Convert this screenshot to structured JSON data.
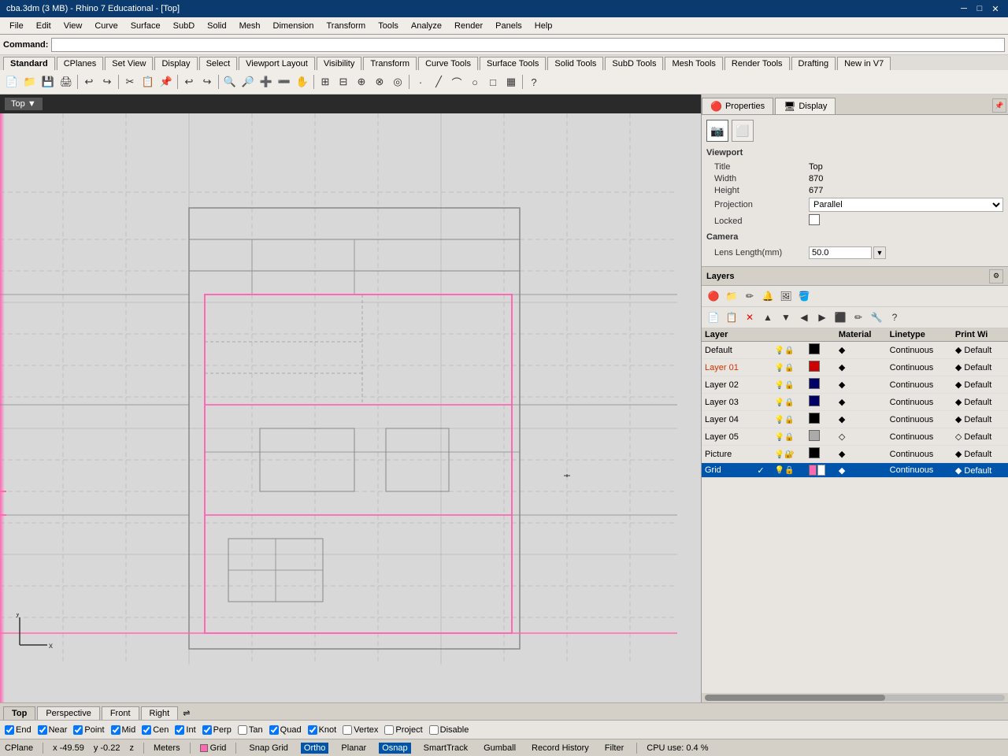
{
  "titlebar": {
    "title": "cba.3dm (3 MB) - Rhino 7 Educational - [Top]",
    "min": "─",
    "max": "□",
    "close": "✕"
  },
  "menu": {
    "items": [
      "File",
      "Edit",
      "View",
      "Curve",
      "Surface",
      "SubD",
      "Solid",
      "Mesh",
      "Dimension",
      "Transform",
      "Tools",
      "Analyze",
      "Render",
      "Panels",
      "Help"
    ]
  },
  "command": {
    "label": "Command:",
    "value": ""
  },
  "toolbar_tabs": [
    "Standard",
    "CPlanes",
    "Set View",
    "Display",
    "Select",
    "Viewport Layout",
    "Visibility",
    "Transform",
    "Curve Tools",
    "Surface Tools",
    "Solid Tools",
    "SubD Tools",
    "Mesh Tools",
    "Render Tools",
    "Drafting",
    "New in V7"
  ],
  "viewport": {
    "title": "Top",
    "title_arrow": "▼"
  },
  "right_panel": {
    "tabs": [
      {
        "label": "Properties",
        "icon": "🔴"
      },
      {
        "label": "Display",
        "icon": "🖥"
      }
    ],
    "active_tab": "Properties"
  },
  "properties": {
    "camera_icon": "📷",
    "rect_icon": "⬜",
    "viewport_label": "Viewport",
    "title_label": "Title",
    "title_value": "Top",
    "width_label": "Width",
    "width_value": "870",
    "height_label": "Height",
    "height_value": "677",
    "projection_label": "Projection",
    "projection_value": "Parallel",
    "locked_label": "Locked",
    "camera_section": "Camera",
    "lens_label": "Lens Length(mm)",
    "lens_value": "50.0"
  },
  "layers": {
    "title": "Layers",
    "toolbar1_icons": [
      "🟥",
      "📁",
      "✏",
      "🔔",
      "🖼",
      "🪣"
    ],
    "toolbar2_icons": [
      "📄",
      "📋",
      "❌",
      "▲",
      "▼",
      "◀",
      "▶",
      "⬛",
      "✏",
      "❓"
    ],
    "columns": [
      "Layer",
      "",
      "",
      "",
      "",
      "Material",
      "Linetype",
      "Print Wi"
    ],
    "rows": [
      {
        "name": "Default",
        "active": false,
        "check": "",
        "color": "#000000",
        "vis": true,
        "lock": false,
        "mat": "",
        "linetype": "Continuous",
        "print": "Default"
      },
      {
        "name": "Layer 01",
        "active": false,
        "check": "",
        "color": "#cc0000",
        "vis": true,
        "lock": false,
        "mat": "",
        "linetype": "Continuous",
        "print": "Default"
      },
      {
        "name": "Layer 02",
        "active": false,
        "check": "",
        "color": "#000066",
        "vis": true,
        "lock": false,
        "mat": "",
        "linetype": "Continuous",
        "print": "Default"
      },
      {
        "name": "Layer 03",
        "active": false,
        "check": "",
        "color": "#000066",
        "vis": true,
        "lock": false,
        "mat": "",
        "linetype": "Continuous",
        "print": "Default"
      },
      {
        "name": "Layer 04",
        "active": false,
        "check": "",
        "color": "#000000",
        "vis": true,
        "lock": false,
        "mat": "",
        "linetype": "Continuous",
        "print": "Default"
      },
      {
        "name": "Layer 05",
        "active": false,
        "check": "",
        "color": "#888888",
        "vis": true,
        "lock": false,
        "mat": "",
        "linetype": "Continuous",
        "print": "Default"
      },
      {
        "name": "Picture",
        "active": false,
        "check": "",
        "color": "#000000",
        "vis": true,
        "lock": true,
        "mat": "",
        "linetype": "Continuous",
        "print": "Default"
      },
      {
        "name": "Grid",
        "active": true,
        "check": "✓",
        "color": "#ff69b4",
        "vis": true,
        "lock": false,
        "mat": "",
        "linetype": "Continuous",
        "print": "Default"
      }
    ]
  },
  "bottom_tabs": [
    "Top",
    "Perspective",
    "Front",
    "Right"
  ],
  "active_bottom_tab": "Top",
  "osnap": {
    "items": [
      {
        "label": "End",
        "checked": true
      },
      {
        "label": "Near",
        "checked": true
      },
      {
        "label": "Point",
        "checked": true
      },
      {
        "label": "Mid",
        "checked": true
      },
      {
        "label": "Cen",
        "checked": true
      },
      {
        "label": "Int",
        "checked": true
      },
      {
        "label": "Perp",
        "checked": true
      },
      {
        "label": "Tan",
        "checked": false
      },
      {
        "label": "Quad",
        "checked": true
      },
      {
        "label": "Knot",
        "checked": true
      },
      {
        "label": "Vertex",
        "checked": false
      },
      {
        "label": "Project",
        "checked": false
      },
      {
        "label": "Disable",
        "checked": false
      }
    ]
  },
  "statusbar": {
    "cplane": "CPlane",
    "x": "x -49.59",
    "y": "y -0.22",
    "z": "z",
    "unit": "Meters",
    "grid": "Grid",
    "snapgrid": "Snap Grid",
    "ortho": "Ortho",
    "planar": "Planar",
    "osnap": "Osnap",
    "smarttrack": "SmartTrack",
    "gumball": "Gumball",
    "history": "Record History",
    "filter": "Filter",
    "cpu": "CPU use: 0.4 %"
  },
  "colors": {
    "accent": "#0a3a6e",
    "pink": "#ff69b4",
    "selected_row": "#0055aa",
    "grid_pink": "#ff69b4"
  },
  "layer_colors": {
    "Default": "#000000",
    "Layer01": "#cc0000",
    "Layer02": "#000066",
    "Layer03": "#000066",
    "Layer04": "#000000",
    "Layer05": "#aaaaaa",
    "Picture": "#000000",
    "Grid_c1": "#ff69b4",
    "Grid_c2": "#ffffff"
  }
}
